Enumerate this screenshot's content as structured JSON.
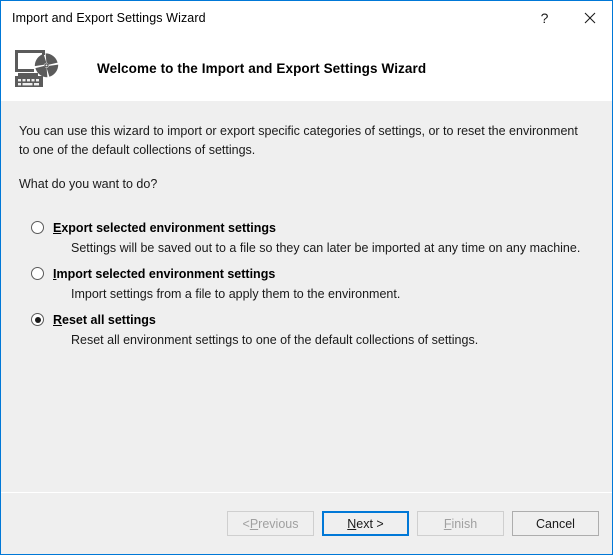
{
  "window": {
    "title": "Import and Export Settings Wizard",
    "border_color": "#0078d7",
    "titlebar_background": "#ffffff",
    "body_background": "#efefef",
    "help_glyph": "?",
    "close_glyph": "✕"
  },
  "header": {
    "heading": "Welcome to the Import and Export Settings Wizard",
    "icon_name": "import-export-settings-icon"
  },
  "main": {
    "intro": "You can use this wizard to import or export specific categories of settings, or to reset the environment to one of the default collections of settings.",
    "question": "What do you want to do?",
    "options": [
      {
        "accel": "E",
        "label_rest": "xport selected environment settings",
        "label_full": "Export selected environment settings",
        "description": "Settings will be saved out to a file so they can later be imported at any time on any machine.",
        "selected": false
      },
      {
        "accel": "I",
        "label_rest": "mport selected environment settings",
        "label_full": "Import selected environment settings",
        "description": "Import settings from a file to apply them to the environment.",
        "selected": false
      },
      {
        "accel": "R",
        "label_rest": "eset all settings",
        "label_full": "Reset all settings",
        "description": "Reset all environment settings to one of the default collections of settings.",
        "selected": true
      }
    ]
  },
  "footer": {
    "buttons": [
      {
        "name": "previous",
        "prefix": "< ",
        "accel": "P",
        "suffix": "revious",
        "label_full": "< Previous",
        "state": "disabled"
      },
      {
        "name": "next",
        "prefix": "",
        "accel": "N",
        "suffix": "ext >",
        "label_full": "Next >",
        "state": "default"
      },
      {
        "name": "finish",
        "prefix": "",
        "accel": "F",
        "suffix": "inish",
        "label_full": "Finish",
        "state": "disabled"
      },
      {
        "name": "cancel",
        "prefix": "",
        "accel": "",
        "suffix": "Cancel",
        "label_full": "Cancel",
        "state": "normal"
      }
    ]
  }
}
